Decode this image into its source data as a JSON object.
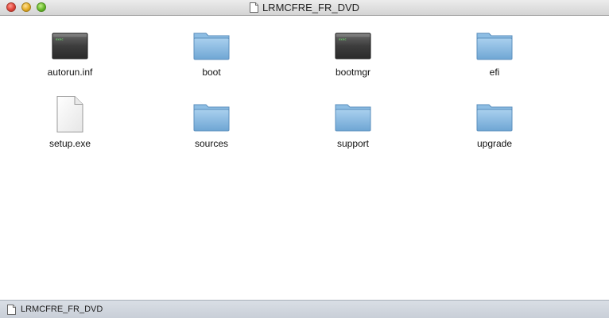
{
  "window": {
    "title": "LRMCFRE_FR_DVD",
    "controls": {
      "close": "close-button",
      "minimize": "minimize-button",
      "zoom": "zoom-button"
    }
  },
  "items": [
    {
      "label": "autorun.inf",
      "icon": "executable-file-icon"
    },
    {
      "label": "boot",
      "icon": "folder-icon"
    },
    {
      "label": "bootmgr",
      "icon": "executable-file-icon"
    },
    {
      "label": "efi",
      "icon": "folder-icon"
    },
    {
      "label": "setup.exe",
      "icon": "document-icon"
    },
    {
      "label": "sources",
      "icon": "folder-icon"
    },
    {
      "label": "support",
      "icon": "folder-icon"
    },
    {
      "label": "upgrade",
      "icon": "folder-icon"
    }
  ],
  "statusbar": {
    "path": "LRMCFRE_FR_DVD",
    "icon": "document-icon"
  },
  "colors": {
    "folder": "#7fb3dc",
    "statusbar": "#cfd5dd",
    "exec": "#3a3a3a"
  }
}
